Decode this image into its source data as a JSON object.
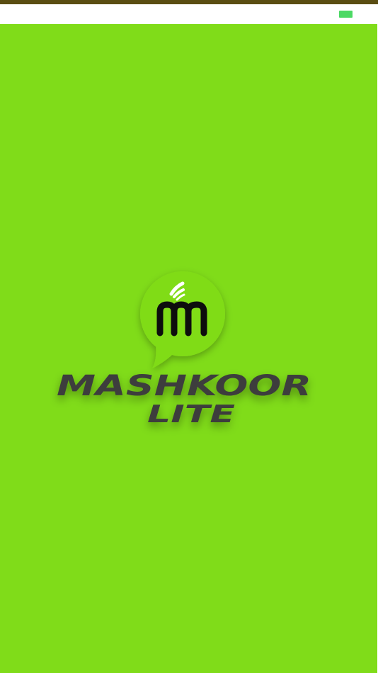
{
  "app": {
    "name_line1": "MASHKOOR",
    "name_line2": "LITE"
  },
  "icons": {
    "battery": "battery-icon",
    "logo": "chat-bubble-m-logo-icon"
  },
  "colors": {
    "splash_background": "#80dc19",
    "top_strip": "#5a4d12",
    "battery": "#4cd964",
    "logo_bubble": "#80dc19",
    "logo_mark": "#111111",
    "wordmark": "#3c3c3c"
  }
}
